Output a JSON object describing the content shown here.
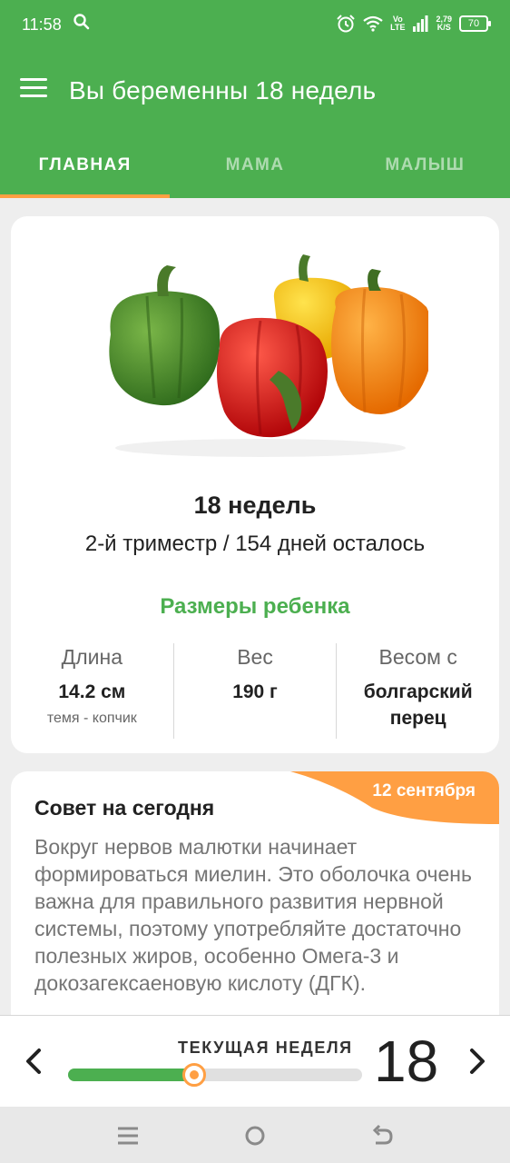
{
  "status": {
    "time": "11:58",
    "network_top": "Vo",
    "network_bottom": "LTE",
    "speed_top": "2,79",
    "speed_bottom": "K/S",
    "battery": "70"
  },
  "appbar": {
    "title": "Вы беременны 18 недель"
  },
  "tabs": [
    {
      "label": "ГЛАВНАЯ",
      "active": true
    },
    {
      "label": "МАМА",
      "active": false
    },
    {
      "label": "МАЛЫШ",
      "active": false
    }
  ],
  "week_card": {
    "week_title": "18 недель",
    "subtitle": "2-й триместр / 154 дней осталось",
    "sizes_title": "Размеры ребенка",
    "length": {
      "label": "Длина",
      "value": "14.2 см",
      "note": "темя - копчик"
    },
    "weight": {
      "label": "Вес",
      "value": "190 г"
    },
    "compare": {
      "label": "Весом с",
      "value": "болгарский перец"
    }
  },
  "tip_card": {
    "date": "12 сентября",
    "title": "Совет на сегодня",
    "body": "Вокруг нервов малютки начинает формироваться миелин. Это оболочка очень важна для правильного развития нервной системы, поэтому употребляйте достаточно полезных жиров, особенно Омега-3 и докозагексаеновую кислоту (ДГК)."
  },
  "week_selector": {
    "label": "ТЕКУЩАЯ НЕДЕЛЯ",
    "number": "18",
    "progress": 0.43
  },
  "colors": {
    "primary": "#4caf50",
    "accent": "#ff9f43"
  },
  "icons": [
    "menu-icon",
    "search-icon",
    "alarm-icon",
    "wifi-icon",
    "signal-icon",
    "battery-icon",
    "chevron-left-icon",
    "chevron-right-icon",
    "recents-icon",
    "home-icon",
    "back-icon"
  ]
}
